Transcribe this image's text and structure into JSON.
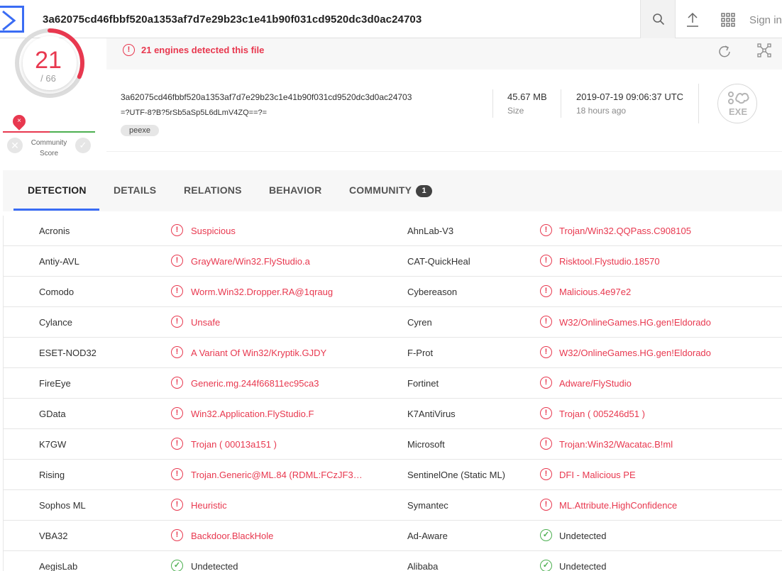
{
  "header": {
    "hash": "3a62075cd46fbbf520a1353af7d7e29b23c1e41b90f031cd9520dc3d0ac24703",
    "signin_label": "Sign in",
    "icons": [
      "logo-icon",
      "search-icon",
      "upload-icon",
      "apps-grid-icon"
    ]
  },
  "score": {
    "detected": "21",
    "total": "/ 66",
    "detected_fraction": 0.318
  },
  "community": {
    "label_line1": "Community",
    "label_line2": "Score",
    "marker": "×",
    "x_icon": "✕",
    "check_icon": "✓"
  },
  "alert": {
    "icon": "!",
    "text": "21 engines detected this file"
  },
  "file": {
    "hash": "3a62075cd46fbbf520a1353af7d7e29b23c1e41b90f031cd9520dc3d0ac24703",
    "name": "=?UTF-8?B?5rSb5aSp5L6dLmV4ZQ==?=",
    "tag": "peexe",
    "size_value": "45.67 MB",
    "size_label": "Size",
    "date_value": "2019-07-19 09:06:37 UTC",
    "date_label": "18 hours ago",
    "type_label": "EXE"
  },
  "tabs": [
    {
      "label": "DETECTION",
      "active": true
    },
    {
      "label": "DETAILS"
    },
    {
      "label": "RELATIONS"
    },
    {
      "label": "BEHAVIOR"
    },
    {
      "label": "COMMUNITY",
      "badge": "1"
    }
  ],
  "detections": [
    {
      "left": {
        "engine": "Acronis",
        "result": "Suspicious",
        "status": "mal"
      },
      "right": {
        "engine": "AhnLab-V3",
        "result": "Trojan/Win32.QQPass.C908105",
        "status": "mal"
      }
    },
    {
      "left": {
        "engine": "Antiy-AVL",
        "result": "GrayWare/Win32.FlyStudio.a",
        "status": "mal"
      },
      "right": {
        "engine": "CAT-QuickHeal",
        "result": "Risktool.Flystudio.18570",
        "status": "mal"
      }
    },
    {
      "left": {
        "engine": "Comodo",
        "result": "Worm.Win32.Dropper.RA@1qraug",
        "status": "mal"
      },
      "right": {
        "engine": "Cybereason",
        "result": "Malicious.4e97e2",
        "status": "mal"
      }
    },
    {
      "left": {
        "engine": "Cylance",
        "result": "Unsafe",
        "status": "mal"
      },
      "right": {
        "engine": "Cyren",
        "result": "W32/OnlineGames.HG.gen!Eldorado",
        "status": "mal"
      }
    },
    {
      "left": {
        "engine": "ESET-NOD32",
        "result": "A Variant Of Win32/Kryptik.GJDY",
        "status": "mal"
      },
      "right": {
        "engine": "F-Prot",
        "result": "W32/OnlineGames.HG.gen!Eldorado",
        "status": "mal"
      }
    },
    {
      "left": {
        "engine": "FireEye",
        "result": "Generic.mg.244f66811ec95ca3",
        "status": "mal"
      },
      "right": {
        "engine": "Fortinet",
        "result": "Adware/FlyStudio",
        "status": "mal"
      }
    },
    {
      "left": {
        "engine": "GData",
        "result": "Win32.Application.FlyStudio.F",
        "status": "mal"
      },
      "right": {
        "engine": "K7AntiVirus",
        "result": "Trojan ( 005246d51 )",
        "status": "mal"
      }
    },
    {
      "left": {
        "engine": "K7GW",
        "result": "Trojan ( 00013a151 )",
        "status": "mal"
      },
      "right": {
        "engine": "Microsoft",
        "result": "Trojan:Win32/Wacatac.B!ml",
        "status": "mal"
      }
    },
    {
      "left": {
        "engine": "Rising",
        "result": "Trojan.Generic@ML.84 (RDML:FCzJF3…",
        "status": "mal"
      },
      "right": {
        "engine": "SentinelOne (Static ML)",
        "result": "DFI - Malicious PE",
        "status": "mal"
      }
    },
    {
      "left": {
        "engine": "Sophos ML",
        "result": "Heuristic",
        "status": "mal"
      },
      "right": {
        "engine": "Symantec",
        "result": "ML.Attribute.HighConfidence",
        "status": "mal"
      }
    },
    {
      "left": {
        "engine": "VBA32",
        "result": "Backdoor.BlackHole",
        "status": "mal"
      },
      "right": {
        "engine": "Ad-Aware",
        "result": "Undetected",
        "status": "clean"
      }
    },
    {
      "left": {
        "engine": "AegisLab",
        "result": "Undetected",
        "status": "clean"
      },
      "right": {
        "engine": "Alibaba",
        "result": "Undetected",
        "status": "clean"
      }
    }
  ],
  "colors": {
    "accent": "#3a6cf4",
    "malicious": "#e8384f",
    "clean": "#4caf50"
  }
}
